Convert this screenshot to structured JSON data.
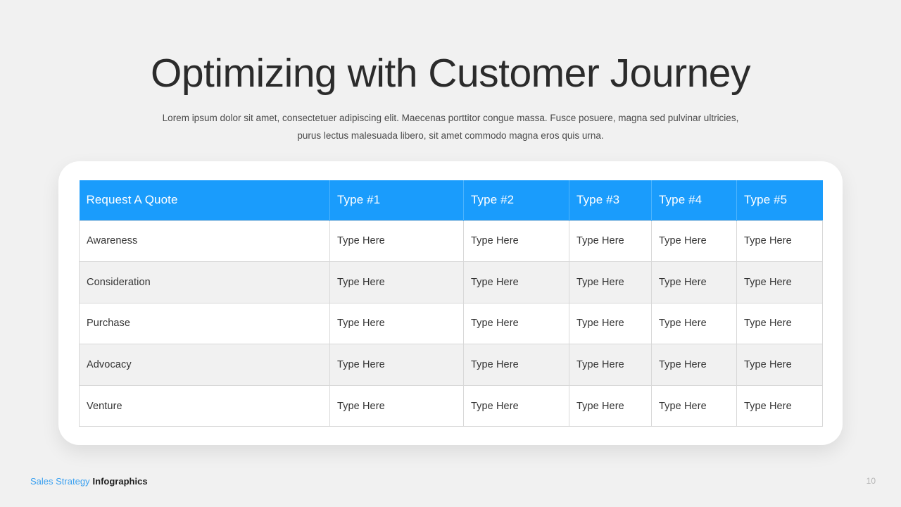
{
  "slide": {
    "title": "Optimizing with Customer Journey",
    "subtitle": "Lorem ipsum dolor sit amet, consectetuer adipiscing elit. Maecenas porttitor congue massa. Fusce posuere, magna sed pulvinar ultricies, purus lectus malesuada libero, sit amet commodo  magna eros quis urna.",
    "page_number": "10"
  },
  "footer": {
    "brand": "Sales Strategy",
    "section": "Infographics"
  },
  "colors": {
    "header_blue": "#1a9cfc",
    "header_divider": "#4db4fd",
    "row_stripe": "#f1f1f1",
    "page_background": "#f1f1f1",
    "card_background": "#ffffff",
    "brand_blue": "#3aa0f0",
    "cell_border": "#d8d8d8"
  },
  "table": {
    "headers": [
      "Request A Quote",
      "Type #1",
      "Type #2",
      "Type #3",
      "Type #4",
      "Type #5"
    ],
    "rows": [
      {
        "label": "Awareness",
        "cells": [
          "Type Here",
          "Type Here",
          "Type Here",
          "Type Here",
          "Type Here"
        ]
      },
      {
        "label": "Consideration",
        "cells": [
          "Type Here",
          "Type Here",
          "Type Here",
          "Type Here",
          "Type Here"
        ]
      },
      {
        "label": "Purchase",
        "cells": [
          "Type Here",
          "Type Here",
          "Type Here",
          "Type Here",
          "Type Here"
        ]
      },
      {
        "label": "Advocacy",
        "cells": [
          "Type Here",
          "Type Here",
          "Type Here",
          "Type Here",
          "Type Here"
        ]
      },
      {
        "label": "Venture",
        "cells": [
          "Type Here",
          "Type Here",
          "Type Here",
          "Type Here",
          "Type Here"
        ]
      }
    ]
  }
}
